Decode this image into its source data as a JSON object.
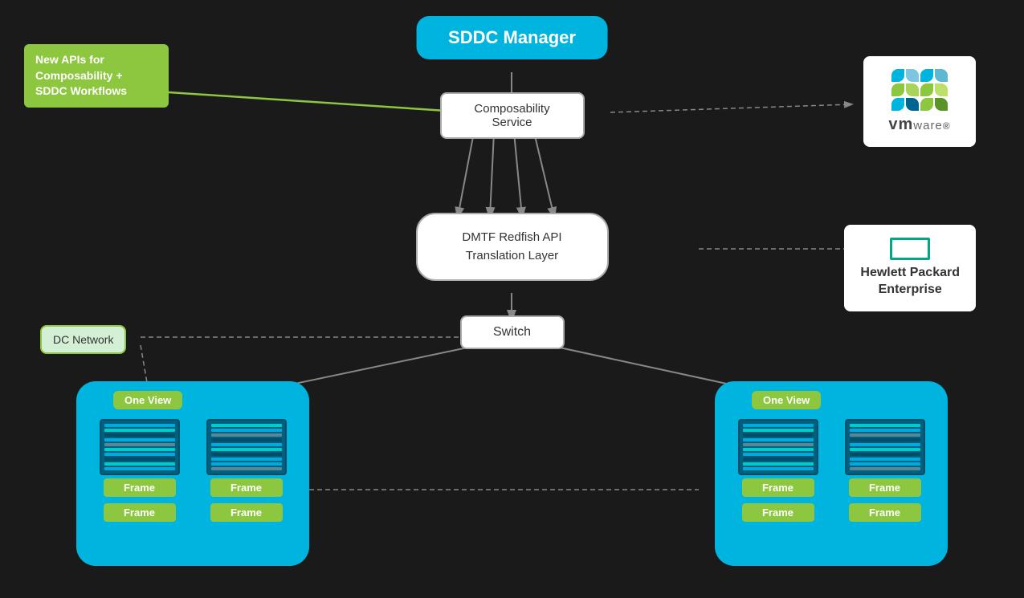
{
  "background": "#1a1a1a",
  "sddc_manager": {
    "label": "SDDC Manager"
  },
  "composability_service": {
    "label": "Composability\nService"
  },
  "annotation": {
    "label": "New APIs for\nComposability +\nSDDC Workflows"
  },
  "dmtf": {
    "label": "DMTF Redfish API\nTranslation Layer"
  },
  "vmware": {
    "label": "vm°ware®"
  },
  "hpe": {
    "label": "Hewlett Packard\nEnterprise"
  },
  "switch_box": {
    "label": "Switch"
  },
  "dc_network": {
    "label": "DC\nNetwork"
  },
  "left_cluster": {
    "one_view_label": "One View",
    "frames": [
      "Frame",
      "Frame",
      "Frame",
      "Frame"
    ]
  },
  "right_cluster": {
    "one_view_label": "One View",
    "frames": [
      "Frame",
      "Frame",
      "Frame",
      "Frame"
    ]
  },
  "colors": {
    "accent_blue": "#00b4e0",
    "accent_green": "#8dc63f",
    "white": "#ffffff",
    "dark_bg": "#1a1a1a"
  }
}
